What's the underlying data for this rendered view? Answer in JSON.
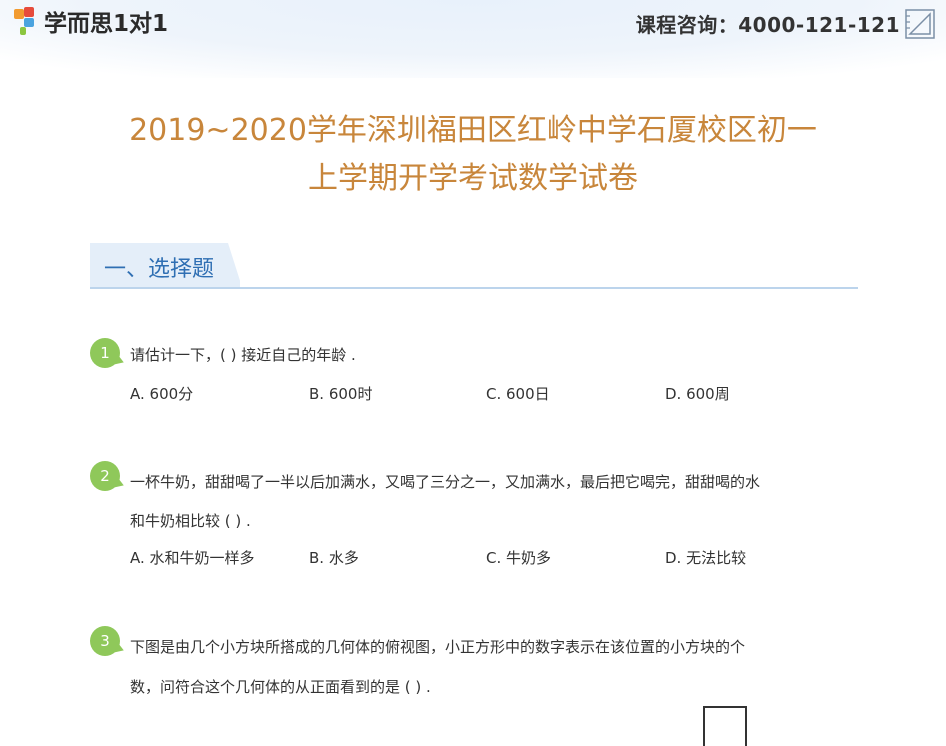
{
  "header": {
    "brand": "学而思1对1",
    "hotline_label": "课程咨询：",
    "hotline_number": "4000-121-121",
    "icons": [
      "brand-logo-icon",
      "ruler-icon"
    ]
  },
  "title": {
    "line1": "2019~2020学年深圳福田区红岭中学石厦校区初一",
    "line2": "上学期开学考试数学试卷"
  },
  "section": {
    "title": "一、选择题"
  },
  "questions": [
    {
      "number": "1",
      "lines": [
        "请估计一下，(      ) 接近自己的年龄 ."
      ],
      "options": [
        "A.  600分",
        "B.  600时",
        "C.  600日",
        "D.  600周"
      ]
    },
    {
      "number": "2",
      "lines": [
        "一杯牛奶，甜甜喝了一半以后加满水，又喝了三分之一，又加满水，最后把它喝完，甜甜喝的水",
        "和牛奶相比较 (      ) ."
      ],
      "options": [
        "A.  水和牛奶一样多",
        "B.  水多",
        "C.  牛奶多",
        "D.  无法比较"
      ]
    },
    {
      "number": "3",
      "lines": [
        "下图是由几个小方块所搭成的几何体的俯视图，小正方形中的数字表示在该位置的小方块的个",
        "数，问符合这个几何体的从正面看到的是 (      ) ."
      ],
      "options": []
    }
  ]
}
